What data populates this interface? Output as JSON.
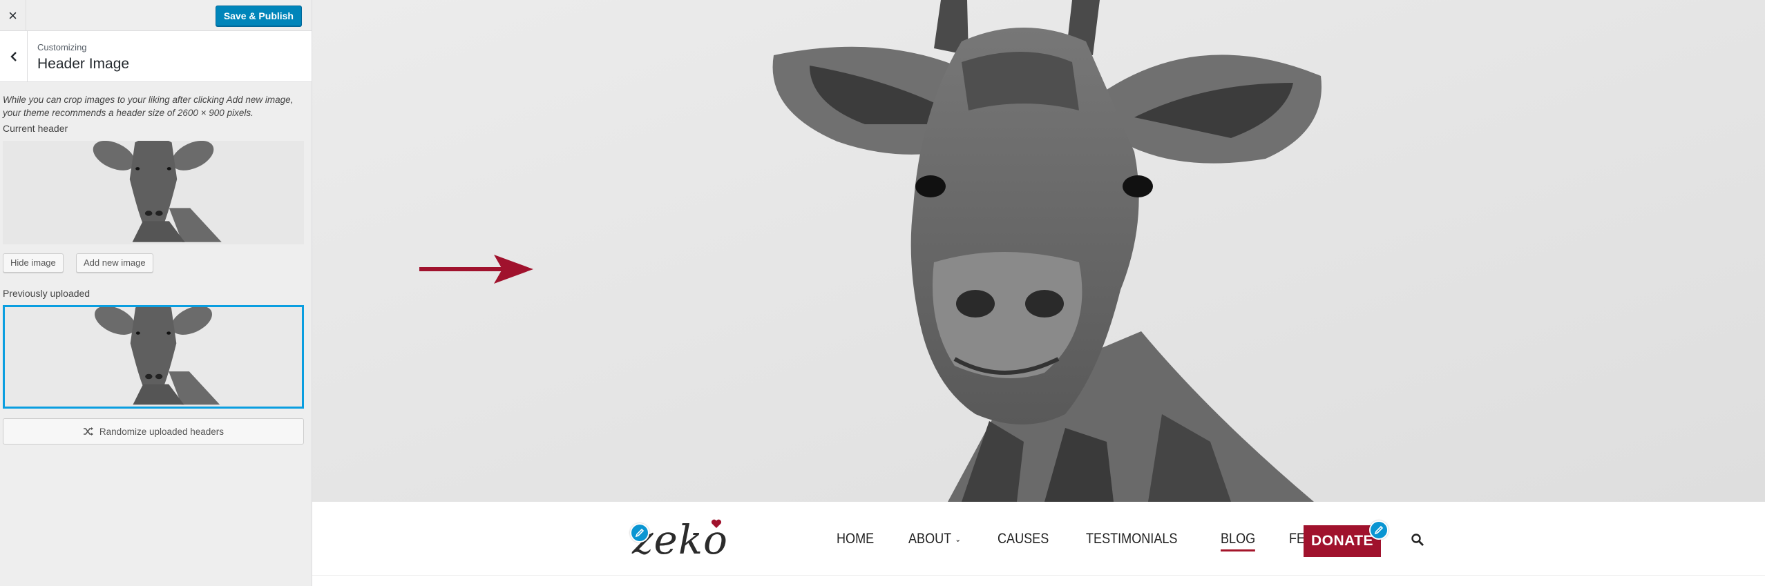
{
  "topbar": {
    "close_symbol": "×",
    "save_label": "Save & Publish"
  },
  "section": {
    "breadcrumb": "Customizing",
    "title": "Header Image"
  },
  "description": "While you can crop images to your liking after clicking Add new image, your theme recommends a header size of 2600 × 900 pixels.",
  "current_header": {
    "label": "Current header",
    "hide_label": "Hide image",
    "add_label": "Add new image"
  },
  "previously_uploaded": {
    "label": "Previously uploaded",
    "randomize_label": "Randomize uploaded headers"
  },
  "site": {
    "logo_text": "zeko",
    "menu": [
      {
        "label": "HOME"
      },
      {
        "label": "ABOUT"
      },
      {
        "label": "CAUSES"
      },
      {
        "label": "TESTIMONIALS"
      },
      {
        "label": "BLOG"
      },
      {
        "label": "FEATURES"
      }
    ],
    "donate_label": "DONATE"
  },
  "colors": {
    "accent": "#0085ba",
    "brand": "#a0122d",
    "selected_border": "#0a9ee0"
  },
  "icons": [
    "close-icon",
    "back-chevron-icon",
    "shuffle-icon",
    "arrow-icon",
    "pencil-icon",
    "heart-icon",
    "search-icon",
    "chevron-down-icon"
  ]
}
